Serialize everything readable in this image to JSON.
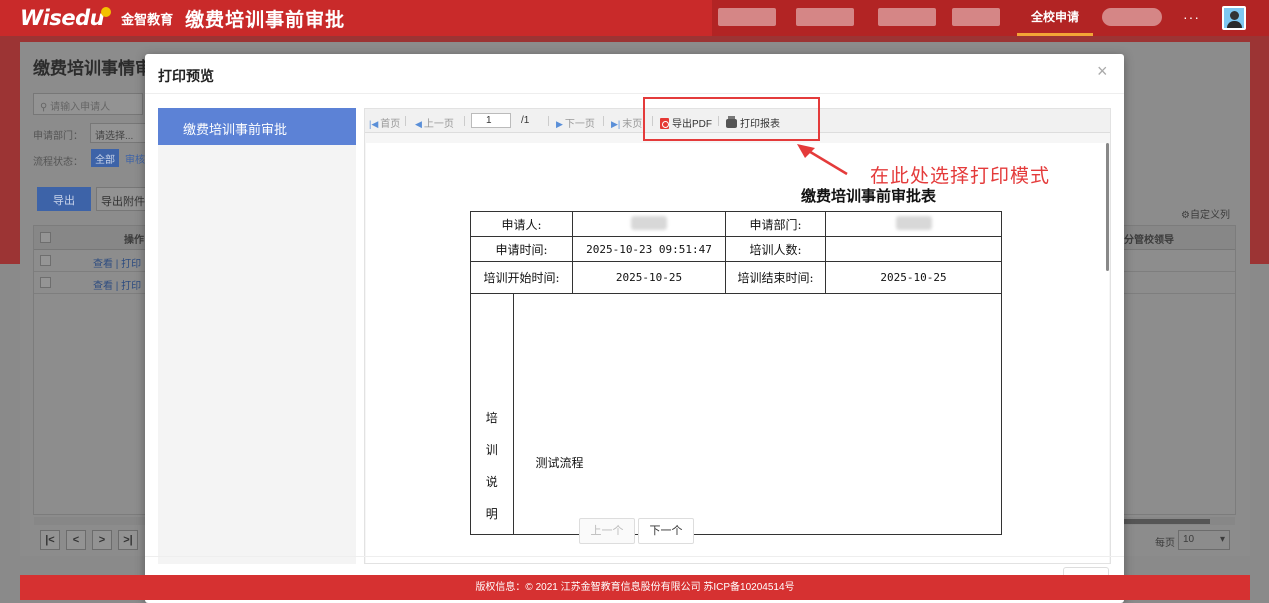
{
  "header": {
    "logo_text": "Wisedu",
    "logo_cn": "金智教育",
    "app_title": "缴费培训事前审批",
    "nav_active": "全校申请",
    "more": "···"
  },
  "background": {
    "page_title": "缴费培训事情审",
    "search_placeholder": "请输入申请人",
    "dept_label": "申请部门：",
    "dept_select": "请选择...",
    "status_label": "流程状态：",
    "status_all": "全部",
    "status_audit": "审核",
    "export_button": "导出",
    "export_attach_button": "导出附件",
    "custom_columns": "自定义列",
    "col_operation": "操作",
    "col_leader": "分管校领导",
    "rows": [
      {
        "actions": "查看 | 打印"
      },
      {
        "actions": "查看 | 打印"
      }
    ],
    "pager_first": "|<",
    "pager_prev": "<",
    "pager_next": ">",
    "pager_last": ">|",
    "per_page_label": "每页",
    "per_page_value": "10"
  },
  "modal": {
    "title": "打印预览",
    "close": "×",
    "left_item": "缴费培训事前审批",
    "toolbar": {
      "first": "首页",
      "prev": "上一页",
      "page_input": "1",
      "page_total": "/1",
      "next": "下一页",
      "last": "末页",
      "export_pdf": "导出PDF",
      "print": "打印报表"
    },
    "document": {
      "title": "缴费培训事前审批表",
      "applicant_label": "申请人:",
      "dept_label": "申请部门:",
      "apply_time_label": "申请时间:",
      "apply_time_value": "2025-10-23 09:51:47",
      "trainee_count_label": "培训人数:",
      "trainee_count_value": "",
      "start_label": "培训开始时间:",
      "start_value": "2025-10-25",
      "end_label": "培训结束时间:",
      "end_value": "2025-10-25",
      "desc_label_chars": [
        "培",
        "训",
        "说",
        "明"
      ],
      "desc_content": "测试流程"
    },
    "prev_button": "上一个",
    "next_button": "下一个"
  },
  "annotation": {
    "text": "在此处选择打印模式",
    "color": "#e43b3b"
  },
  "footer": {
    "text": "版权信息：© 2021 江苏金智教育信息股份有限公司 苏ICP备10204514号"
  },
  "colors": {
    "brand_red": "#c92a2a",
    "accent_blue": "#5c82d6",
    "footer_red": "#d63131"
  }
}
